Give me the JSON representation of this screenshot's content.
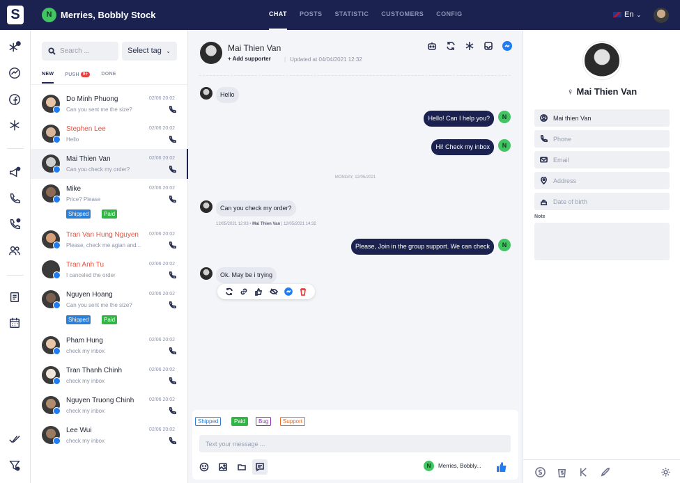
{
  "header": {
    "logo_letter": "S",
    "store_initial": "N",
    "store_name": "Merries, Bobbly Stock",
    "nav": [
      "CHAT",
      "POSTS",
      "STATISTIC",
      "CUSTOMERS",
      "CONFIG"
    ],
    "active_nav": "CHAT",
    "language": "En"
  },
  "sidebar": {
    "icons": [
      "asterisk-plus-icon",
      "messenger-icon",
      "facebook-icon",
      "asterisk-icon",
      "megaphone-icon",
      "phone-icon",
      "phone-blocked-icon",
      "users-icon",
      "document-icon",
      "calendar-icon",
      "double-check-icon",
      "filter-x-icon"
    ]
  },
  "conversation_list": {
    "search_placeholder": "Search ...",
    "tag_select": "Select tag",
    "tabs": [
      {
        "label": "NEW"
      },
      {
        "label": "PUSH",
        "badge": "9+"
      },
      {
        "label": "DONE"
      }
    ],
    "items": [
      {
        "name": "Do Minh Phuong",
        "date": "02/06 20:02",
        "preview": "Can you sent me the size?",
        "highlight": false
      },
      {
        "name": "Stephen Lee",
        "date": "02/06 20:02",
        "preview": "Hello",
        "highlight": true
      },
      {
        "name": "Mai Thien Van",
        "date": "02/06 20:02",
        "preview": "Can you check my order?",
        "highlight": false,
        "selected": true
      },
      {
        "name": "Mike",
        "date": "02/06 20:02",
        "preview": "Price? Please",
        "highlight": false,
        "tags": [
          "Shipped",
          "Paid"
        ]
      },
      {
        "name": "Tran Van Hung Nguyen",
        "date": "02/06 20:02",
        "preview": "Please, check me agian and...",
        "highlight": true
      },
      {
        "name": "Tran Anh Tu",
        "date": "02/06 20:02",
        "preview": "I canceled the order",
        "highlight": true
      },
      {
        "name": "Nguyen Hoang",
        "date": "02/06 20:02",
        "preview": "Can you sent me the size?",
        "highlight": false,
        "tags": [
          "Shipped",
          "Paid"
        ]
      },
      {
        "name": "Pham Hung",
        "date": "02/06 20:02",
        "preview": "check my inbox",
        "highlight": false
      },
      {
        "name": "Tran Thanh Chinh",
        "date": "02/06 20:02",
        "preview": "check my inbox",
        "highlight": false
      },
      {
        "name": "Nguyen Truong Chinh",
        "date": "02/06 20:02",
        "preview": "check my inbox",
        "highlight": false
      },
      {
        "name": "Lee Wui",
        "date": "02/06 20:02",
        "preview": "check my inbox",
        "highlight": false
      }
    ]
  },
  "chat": {
    "contact_name": "Mai Thien Van",
    "add_supporter": "Add supporter",
    "updated": "Updated at 04/04/2021 12:32",
    "messages": [
      {
        "dir": "in",
        "text": "Hello"
      },
      {
        "dir": "out",
        "text": "Hello! Can I help you?"
      },
      {
        "dir": "out",
        "text": "Hi! Check my inbox"
      },
      {
        "dir": "in",
        "text": "Can you check my order?"
      },
      {
        "dir": "out",
        "text": "Please, Join in the group support. We can check"
      },
      {
        "dir": "in",
        "text": "Ok. May be i trying"
      }
    ],
    "day_separator": "MONDAY, 12/05/2021",
    "meta_time": "12/05/2021 12:03",
    "meta_author": "Mai Thien Van",
    "meta_seen": "| 12/05/2021 14:32",
    "agent_initial": "N",
    "quick_tags": [
      "Shipped",
      "Paid",
      "Bug",
      "Support"
    ],
    "input_placeholder": "Text your message ...",
    "sender_name": "Merries, Bobbly..."
  },
  "profile": {
    "name": "Mai Thien Van",
    "fields": {
      "name_value": "Mai thien Van",
      "phone_placeholder": "Phone",
      "email_placeholder": "Email",
      "address_placeholder": "Address",
      "dob_placeholder": "Date of birth"
    },
    "note_label": "Note"
  },
  "colors": {
    "navy": "#1b2250",
    "green_badge": "#43c463",
    "messenger_blue": "#1f7cf2",
    "highlight_red": "#e55545",
    "shipped_blue": "#2b7fd6",
    "paid_green": "#33b545"
  }
}
